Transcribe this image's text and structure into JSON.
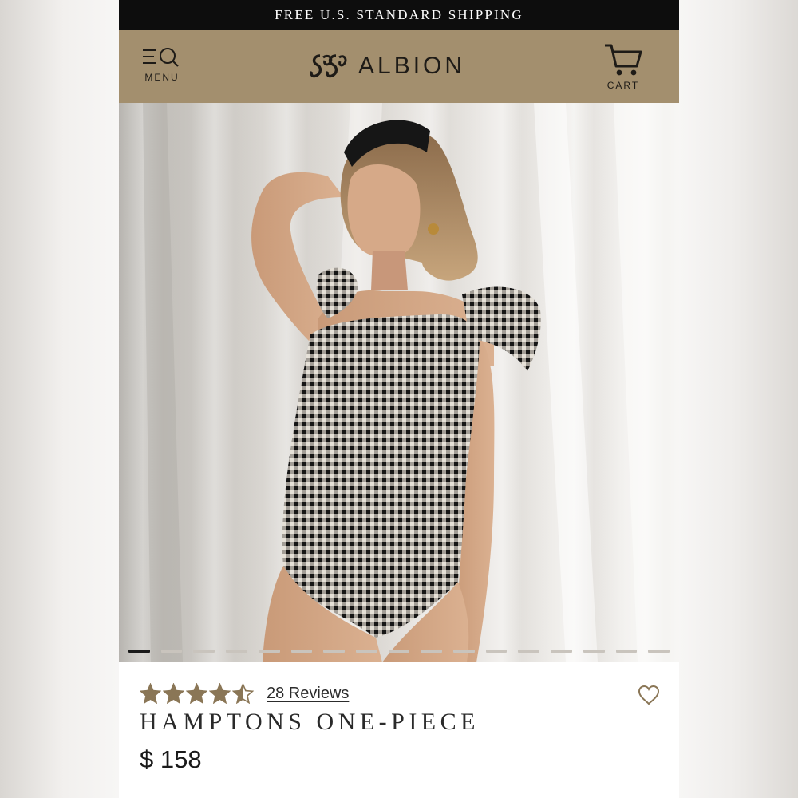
{
  "promo": {
    "text": "FREE U.S. STANDARD SHIPPING"
  },
  "header": {
    "menu_label": "MENU",
    "brand": "ALBION",
    "cart_label": "CART",
    "bg_color": "#a38f6e"
  },
  "carousel": {
    "slide_count": 17,
    "active_index": 0
  },
  "product": {
    "rating": 4.5,
    "rating_max": 5,
    "reviews_label": "28 Reviews",
    "title": "HAMPTONS ONE-PIECE",
    "price": "$ 158",
    "star_color": "#8a7656"
  },
  "icons": {
    "menu": "menu-search-icon",
    "logo": "albion-monogram-icon",
    "cart": "cart-icon",
    "wishlist": "heart-outline-icon",
    "rating": "star-icon"
  }
}
